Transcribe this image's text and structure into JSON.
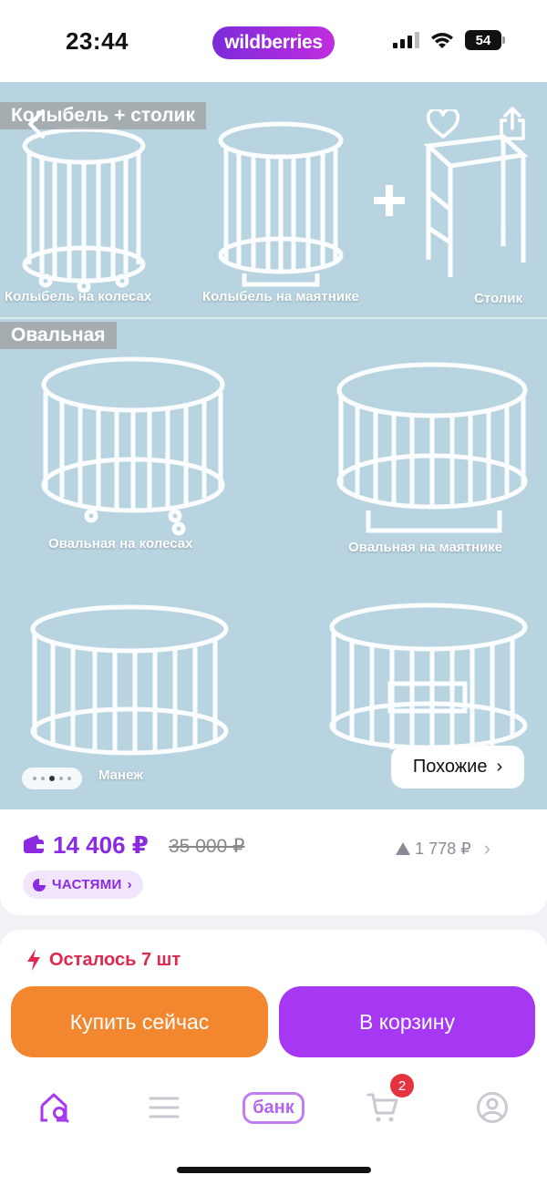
{
  "status_bar": {
    "time": "23:44",
    "brand": "wildberries",
    "battery": "54"
  },
  "gallery": {
    "tag_top": "Колыбель + столик",
    "captions_top": [
      "Колыбель на колесах",
      "Колыбель на маятнике",
      "Столик"
    ],
    "tag_oval": "Овальная",
    "captions_oval": [
      "Овальная на колесах",
      "Овальная на маятнике"
    ],
    "caption_playpen": "Манеж",
    "similar_label": "Похожие",
    "dots_total": 5,
    "dots_active": 3
  },
  "price": {
    "current": "14 406 ₽",
    "old": "35 000 ₽",
    "delta": "1 778 ₽",
    "installments_label": "ЧАСТЯМИ"
  },
  "stock_text": "Осталось 7 шт",
  "buttons": {
    "buy_now": "Купить сейчас",
    "to_cart": "В корзину"
  },
  "nav": {
    "bank_label": "банк",
    "cart_badge": "2"
  },
  "colors": {
    "accent": "#a637f2",
    "buy": "#f3872f",
    "price": "#8a2be2",
    "stock": "#e0274d",
    "gallery_bg": "#b8d4e1"
  }
}
